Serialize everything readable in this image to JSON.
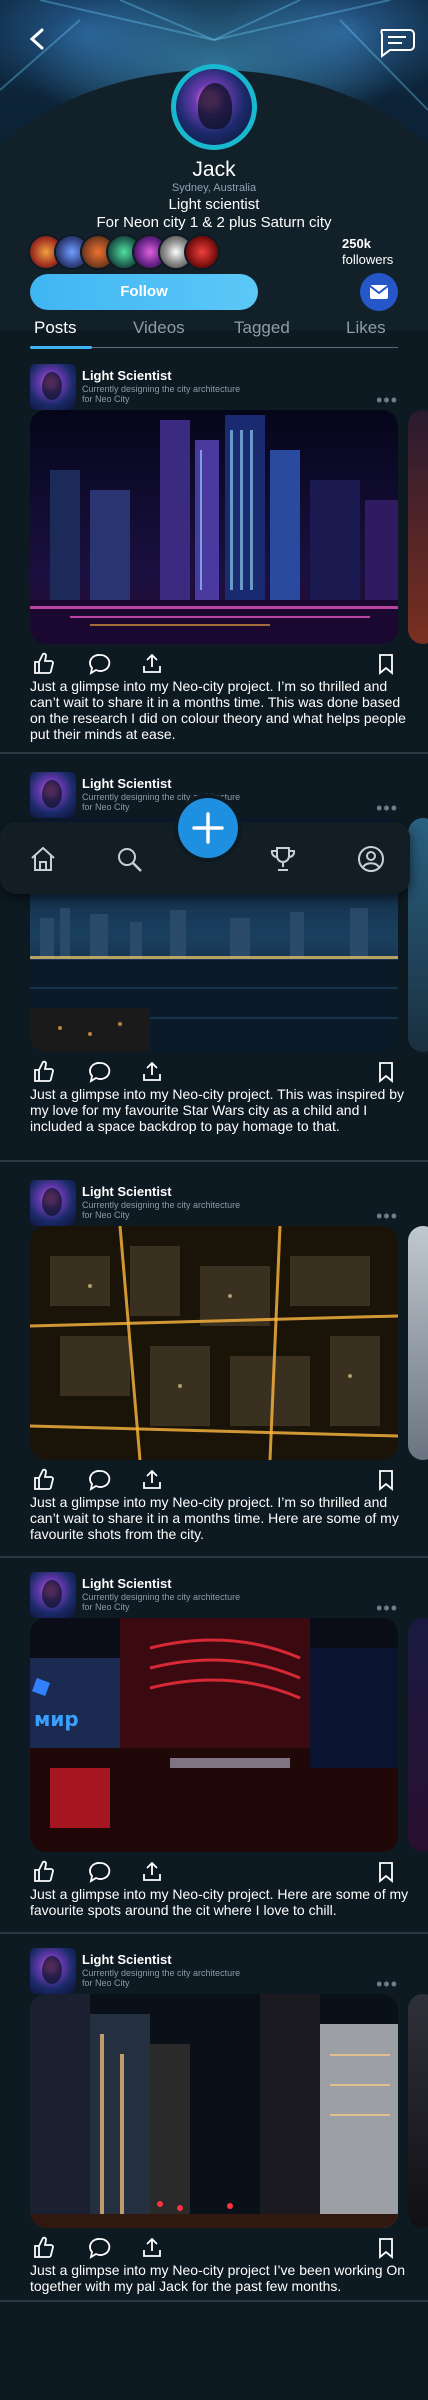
{
  "profile": {
    "name": "Jack",
    "location": "Sydney, Australia",
    "bio_line1": "Light scientist",
    "bio_line2": "For Neon city 1 & 2 plus Saturn city",
    "followers_count": "250k",
    "followers_label": "followers",
    "follow_label": "Follow"
  },
  "tabs": [
    {
      "label": "Posts",
      "active": true
    },
    {
      "label": "Videos",
      "active": false
    },
    {
      "label": "Tagged",
      "active": false
    },
    {
      "label": "Likes",
      "active": false
    }
  ],
  "posts": [
    {
      "author": "Light Scientist",
      "subtitle": "Currently designing the city architecture for Neo City",
      "more": "•••",
      "caption": "Just a glimpse into my Neo-city project. I’m so thrilled and can’t wait to share it in a months time. This was done based on the research I did on colour theory and what helps people put their minds at ease."
    },
    {
      "author": "Light Scientist",
      "subtitle": "Currently designing the city architecture for Neo City",
      "more": "•••",
      "caption": "Just a glimpse into my Neo-city project. This was inspired by my love for my favourite Star Wars city as a child and I included a space backdrop to pay homage to that."
    },
    {
      "author": "Light Scientist",
      "subtitle": "Currently designing the city architecture for Neo City",
      "more": "•••",
      "caption": "Just a glimpse into my Neo-city project. I’m so thrilled and can’t wait to share it in a months time. Here are some of my favourite shots from the city."
    },
    {
      "author": "Light Scientist",
      "subtitle": "Currently designing the city architecture for Neo City",
      "more": "•••",
      "caption": "Just a glimpse into my Neo-city project. Here are some of my favourite spots around the cit where I love to chill.",
      "image_text": "мир"
    },
    {
      "author": "Light Scientist",
      "subtitle": "Currently designing the city architecture for Neo City",
      "more": "•••",
      "caption": "Just a glimpse into my Neo-city project I’ve been working On together with my pal Jack for the past few months."
    }
  ],
  "icons": {
    "back": "chevron-left-icon",
    "chat": "chat-bubble-icon",
    "mail": "envelope-icon",
    "like": "thumbs-up-icon",
    "comment": "comment-icon",
    "share": "share-icon",
    "bookmark": "bookmark-icon",
    "home": "home-icon",
    "search": "search-icon",
    "add": "plus-icon",
    "trophy": "trophy-icon",
    "profile": "user-icon"
  },
  "colors": {
    "accent": "#3fb6f3",
    "fab": "#1f8fe0",
    "mail_button": "#2557c9",
    "background": "#0d1a22"
  }
}
